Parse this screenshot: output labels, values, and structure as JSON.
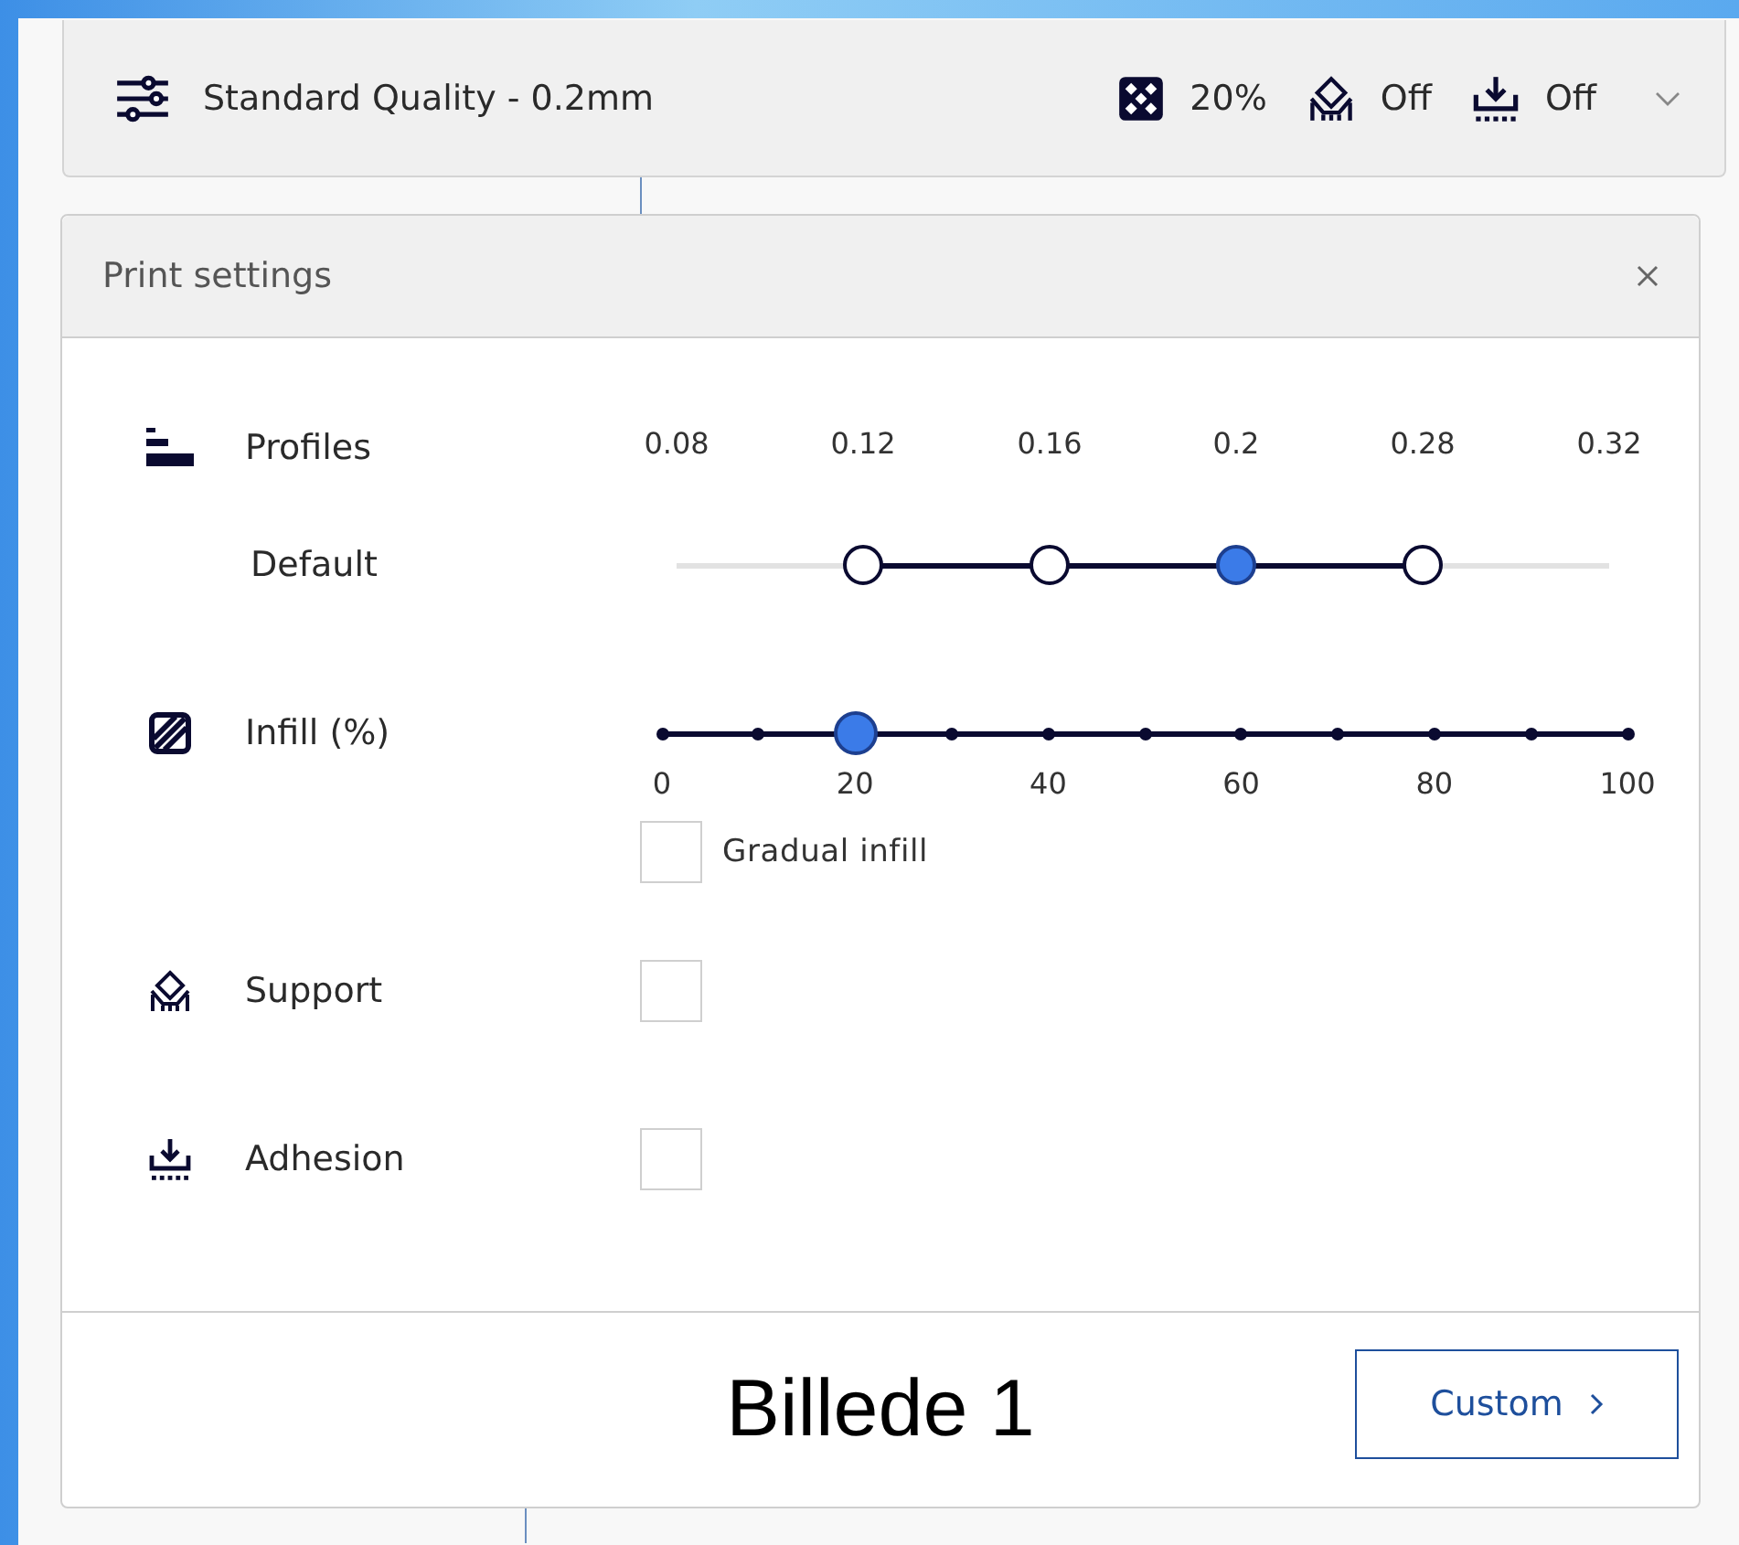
{
  "top_bar": {
    "quality": "Standard Quality - 0.2mm",
    "infill": "20%",
    "support": "Off",
    "adhesion": "Off"
  },
  "panel": {
    "title": "Print settings"
  },
  "profiles": {
    "label": "Profiles",
    "sublabel": "Default",
    "options": [
      {
        "label": "0.08",
        "available": false,
        "selected": false
      },
      {
        "label": "0.12",
        "available": true,
        "selected": false
      },
      {
        "label": "0.16",
        "available": true,
        "selected": false
      },
      {
        "label": "0.2",
        "available": true,
        "selected": true
      },
      {
        "label": "0.28",
        "available": true,
        "selected": false
      },
      {
        "label": "0.32",
        "available": false,
        "selected": false
      }
    ]
  },
  "infill": {
    "label": "Infill (%)",
    "level": 0.2,
    "ticks": [
      "0",
      "20",
      "40",
      "60",
      "80",
      "100"
    ],
    "gradual": {
      "label": "Gradual infill",
      "checked": false
    }
  },
  "support": {
    "label": "Support",
    "checked": false
  },
  "adhesion": {
    "label": "Adhesion",
    "checked": false
  },
  "footer": {
    "caption": "Billede 1",
    "button": "Custom"
  }
}
